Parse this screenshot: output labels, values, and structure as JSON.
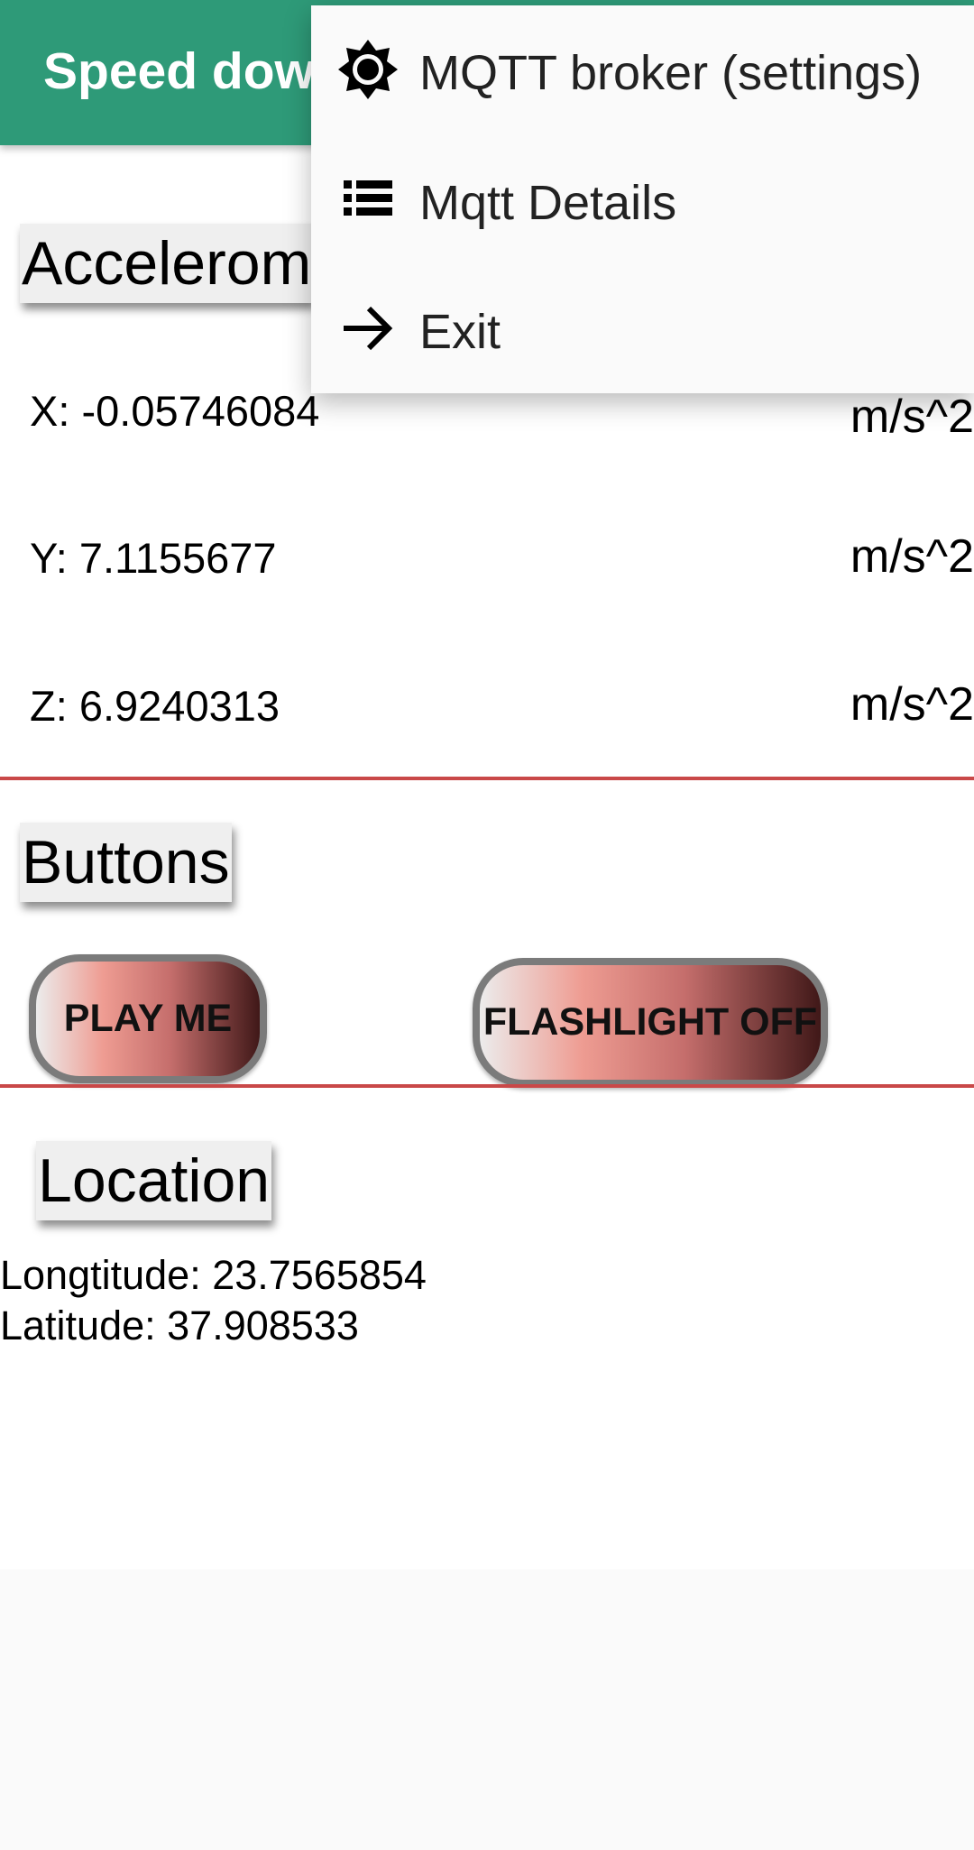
{
  "appbar": {
    "title": "Speed dow"
  },
  "accelerometer": {
    "label": "Accelerom",
    "x": "X: -0.05746084",
    "y": "Y: 7.1155677",
    "z": "Z: 6.9240313",
    "unit": "m/s^2"
  },
  "buttons": {
    "label": "Buttons",
    "play": "PLAY ME",
    "flashlight": "FLASHLIGHT OFF"
  },
  "location": {
    "label": "Location",
    "longitude": "Longtitude: 23.7565854",
    "latitude": "Latitude: 37.908533"
  },
  "menu": {
    "items": [
      {
        "label": "MQTT broker (settings)",
        "icon": "brightness-icon"
      },
      {
        "label": "Mqtt Details",
        "icon": "list-icon"
      },
      {
        "label": "Exit",
        "icon": "arrow-right-icon"
      }
    ]
  },
  "colors": {
    "appbar": "#2e9a78",
    "divider": "#c94848"
  }
}
